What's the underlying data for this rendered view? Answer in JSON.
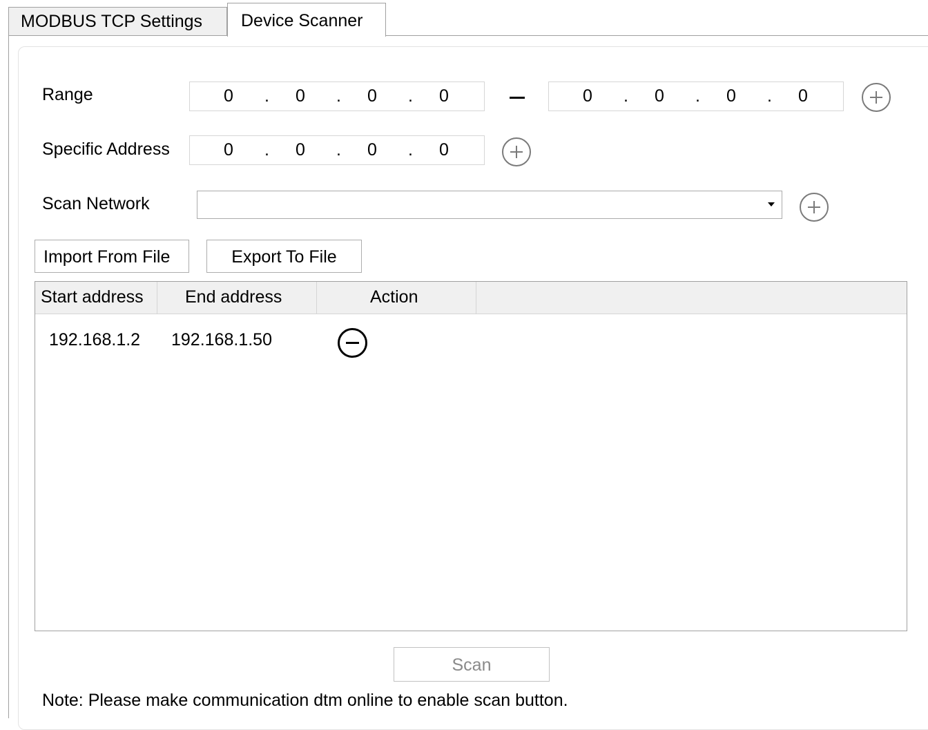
{
  "tabs": [
    {
      "label": "MODBUS TCP Settings"
    },
    {
      "label": "Device Scanner"
    }
  ],
  "range": {
    "label": "Range",
    "start": {
      "octets": [
        "0",
        "0",
        "0",
        "0"
      ]
    },
    "end": {
      "octets": [
        "0",
        "0",
        "0",
        "0"
      ]
    }
  },
  "specific": {
    "label": "Specific Address",
    "octets": [
      "0",
      "0",
      "0",
      "0"
    ]
  },
  "scan_network": {
    "label": "Scan Network",
    "value": ""
  },
  "buttons": {
    "import": "Import From File",
    "export": "Export To File",
    "scan": "Scan"
  },
  "grid": {
    "columns": [
      "Start address",
      "End address",
      "Action"
    ],
    "rows": [
      {
        "start": "192.168.1.2",
        "end": "192.168.1.50"
      }
    ]
  },
  "note": "Note: Please make communication dtm online to enable scan button.",
  "icons": {
    "add": "plus-circle-icon",
    "remove": "minus-circle-icon",
    "dropdown": "chevron-down-icon"
  }
}
